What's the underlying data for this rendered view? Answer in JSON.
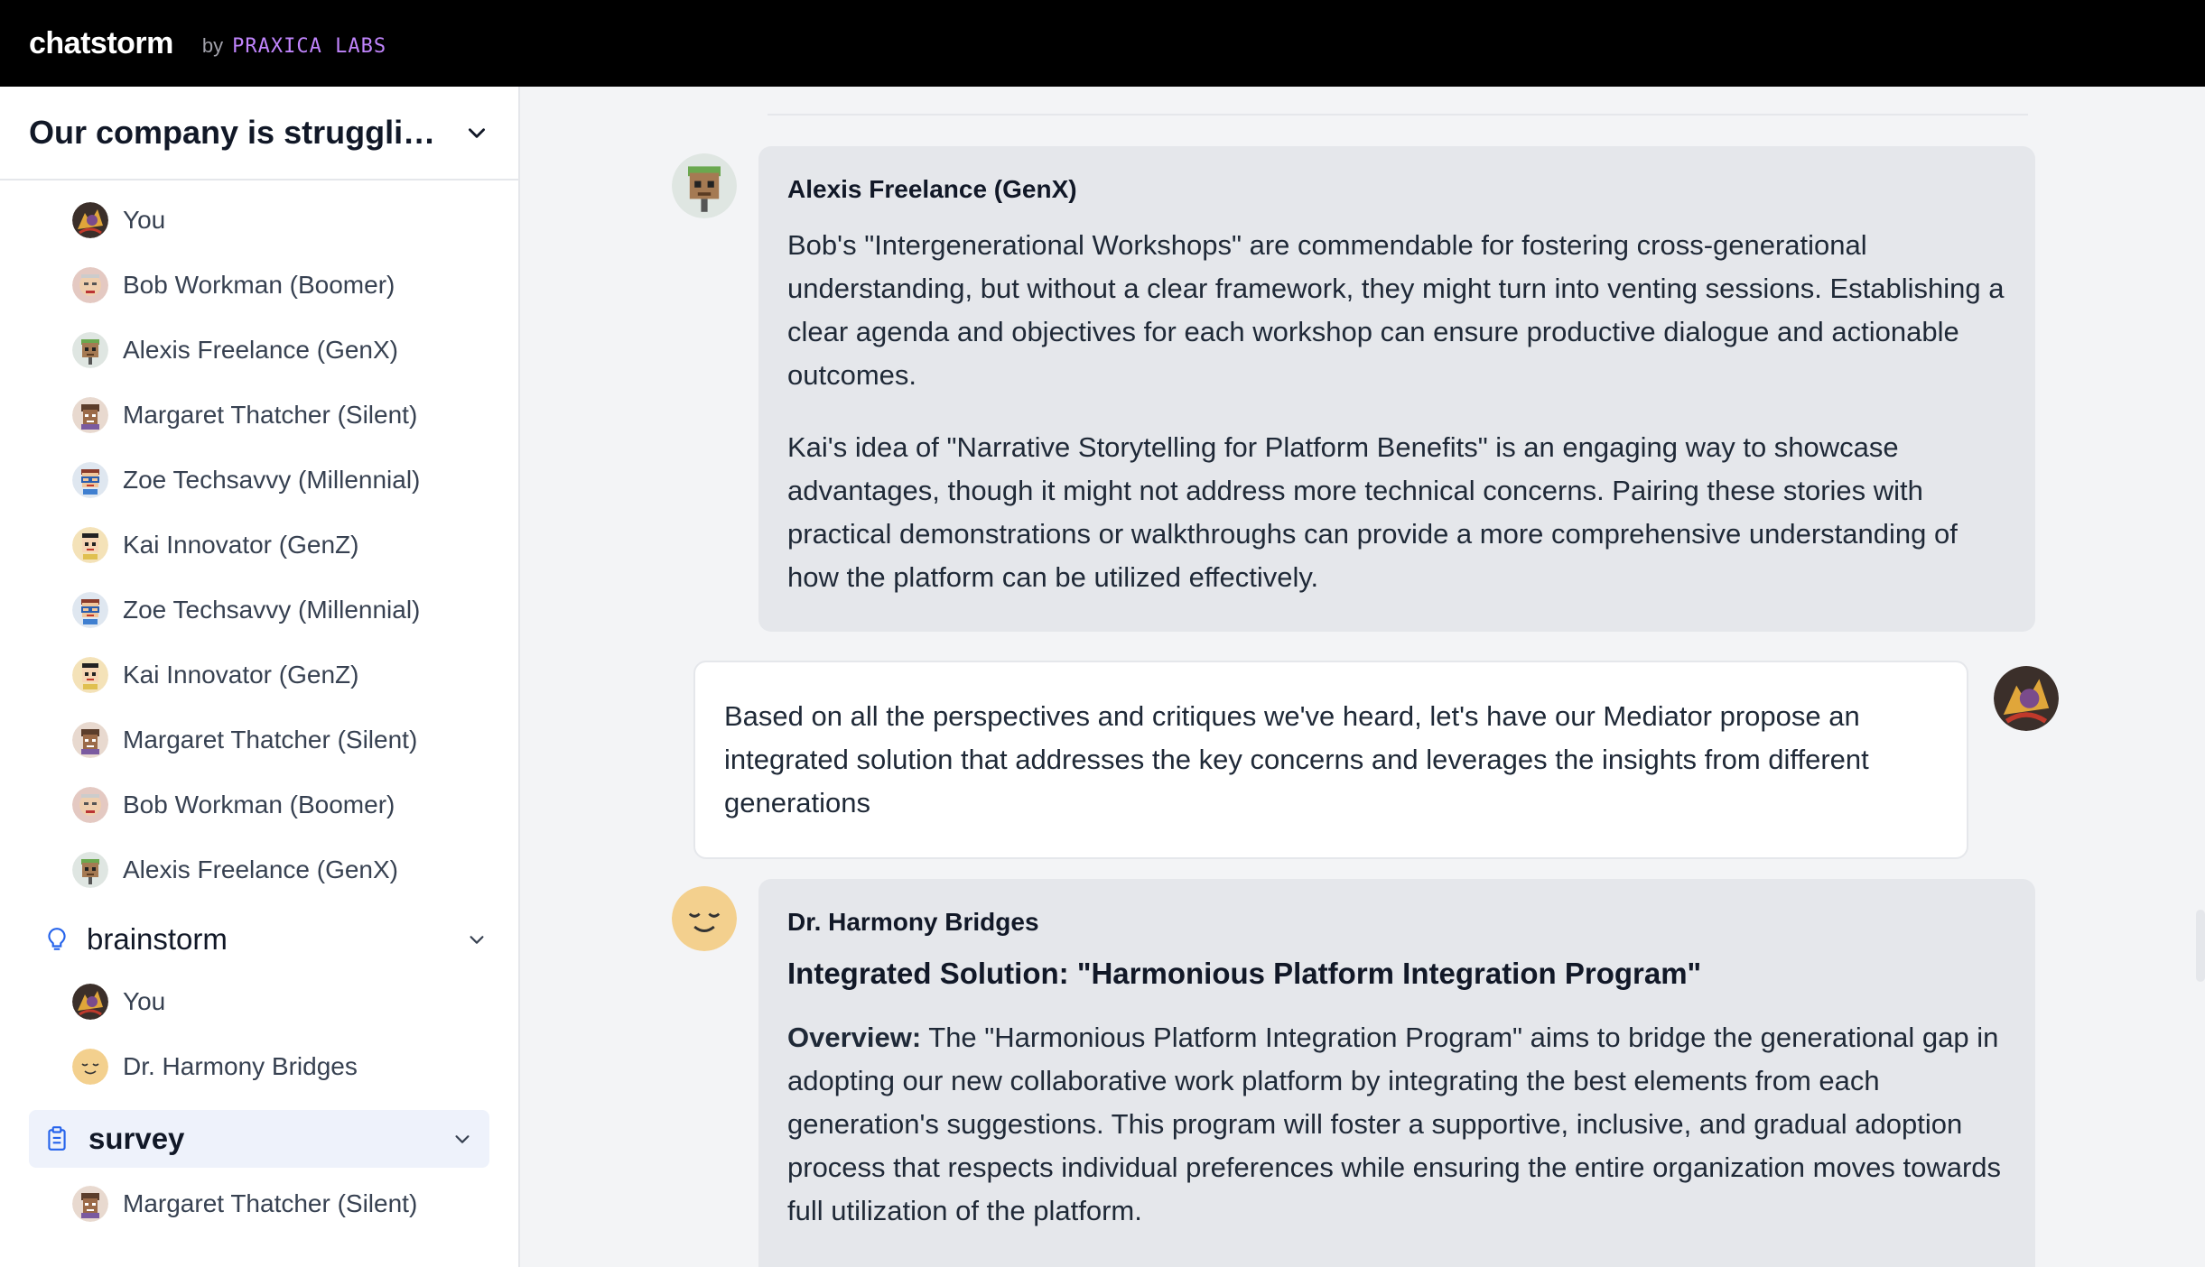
{
  "app": {
    "name": "chatstorm",
    "by": "by",
    "company": "PRAXICA LABS"
  },
  "sidebar": {
    "title": "Our company is struggli…",
    "participants": [
      {
        "name": "You",
        "avatar": "you"
      },
      {
        "name": "Bob Workman (Boomer)",
        "avatar": "bob"
      },
      {
        "name": "Alexis Freelance (GenX)",
        "avatar": "alexis"
      },
      {
        "name": "Margaret Thatcher (Silent)",
        "avatar": "margaret"
      },
      {
        "name": "Zoe Techsavvy (Millennial)",
        "avatar": "zoe"
      },
      {
        "name": "Kai Innovator (GenZ)",
        "avatar": "kai"
      },
      {
        "name": "Zoe Techsavvy (Millennial)",
        "avatar": "zoe"
      },
      {
        "name": "Kai Innovator (GenZ)",
        "avatar": "kai"
      },
      {
        "name": "Margaret Thatcher (Silent)",
        "avatar": "margaret"
      },
      {
        "name": "Bob Workman (Boomer)",
        "avatar": "bob"
      },
      {
        "name": "Alexis Freelance (GenX)",
        "avatar": "alexis"
      }
    ],
    "groups": [
      {
        "label": "brainstorm",
        "icon": "lightbulb-icon",
        "members": [
          {
            "name": "You",
            "avatar": "you"
          },
          {
            "name": "Dr. Harmony Bridges",
            "avatar": "harmony"
          }
        ]
      },
      {
        "label": "survey",
        "icon": "clipboard-icon",
        "members": [
          {
            "name": "Margaret Thatcher (Silent)",
            "avatar": "margaret"
          }
        ]
      }
    ]
  },
  "messages": [
    {
      "sender": "Alexis Freelance (GenX)",
      "paragraphs": [
        "Bob's \"Intergenerational Workshops\" are commendable for fostering cross-generational understanding, but without a clear framework, they might turn into venting sessions. Establishing a clear agenda and objectives for each workshop can ensure productive dialogue and actionable outcomes.",
        "Kai's idea of \"Narrative Storytelling for Platform Benefits\" is an engaging way to showcase advantages, though it might not address more technical concerns. Pairing these stories with practical demonstrations or walkthroughs can provide a more comprehensive understanding of how the platform can be utilized effectively."
      ]
    },
    {
      "sender": "You",
      "paragraphs": [
        "Based on all the perspectives and critiques we've heard, let's have our Mediator propose an integrated solution that addresses the key concerns and leverages the insights from different generations"
      ]
    },
    {
      "sender": "Dr. Harmony Bridges",
      "heading": "Integrated Solution: \"Harmonious Platform Integration Program\"",
      "overview_label": "Overview:",
      "overview_text": " The \"Harmonious Platform Integration Program\" aims to bridge the generational gap in adopting our new collaborative work platform by integrating the best elements from each generation's suggestions. This program will foster a supportive, inclusive, and gradual adoption process that respects individual preferences while ensuring the entire organization moves towards full utilization of the platform."
    }
  ],
  "colors": {
    "topbar": "#000000",
    "labs": "#c084fc",
    "ai_bubble": "#e5e7eb",
    "active_group": "#eef2fb"
  }
}
